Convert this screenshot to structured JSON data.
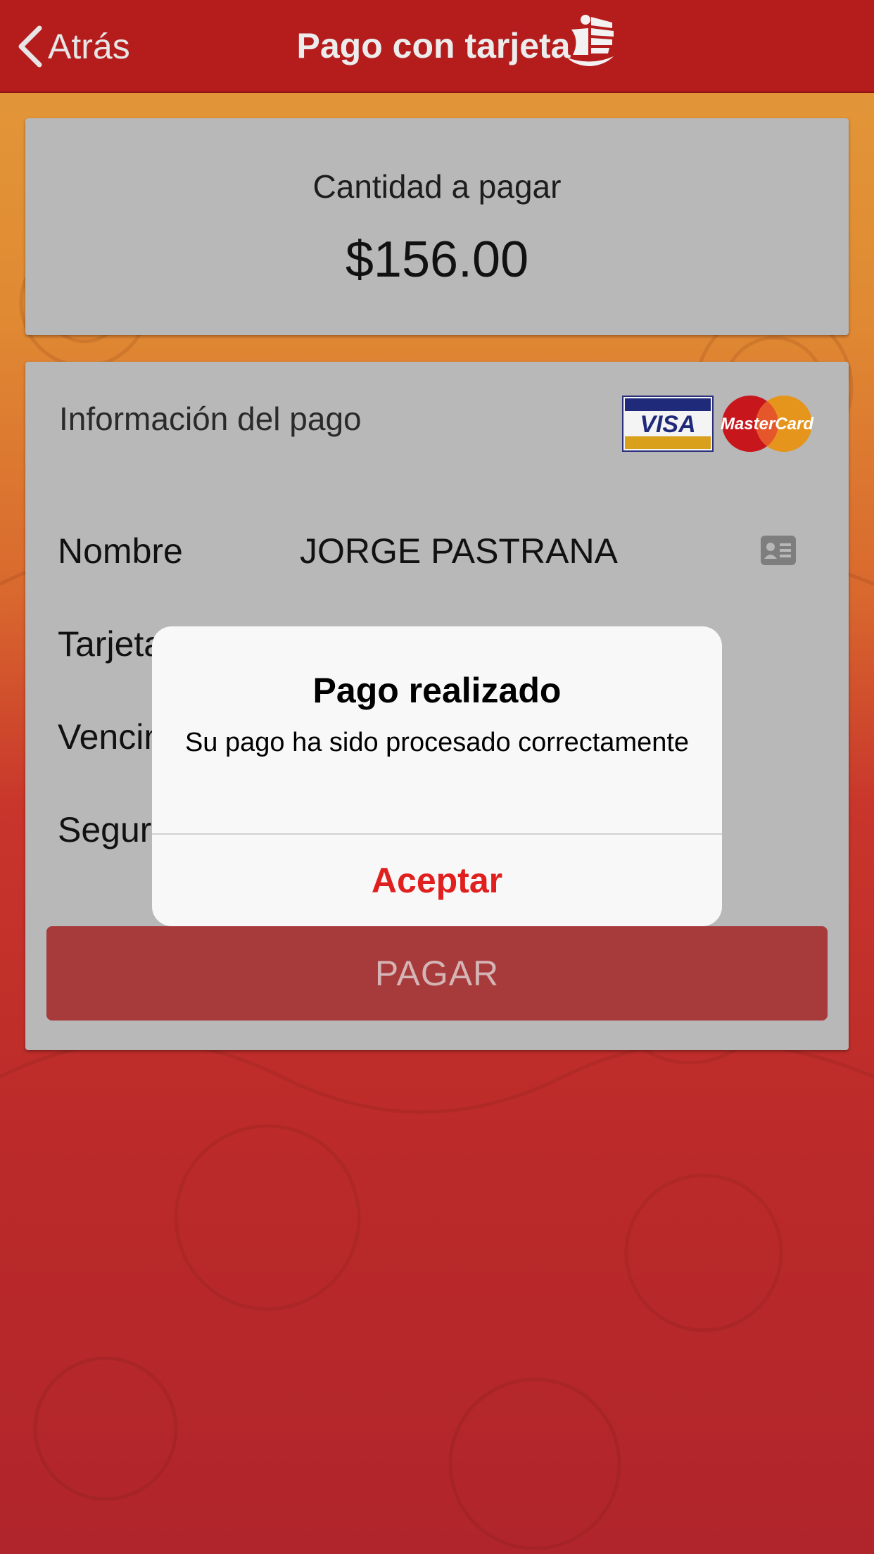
{
  "navbar": {
    "back_label": "Atrás",
    "title": "Pago con tarjeta"
  },
  "amount": {
    "label": "Cantidad a pagar",
    "value": "$156.00"
  },
  "payment_info": {
    "title": "Información del pago",
    "card_brands": [
      "VISA",
      "MasterCard"
    ],
    "rows": [
      {
        "label": "Nombre",
        "value": "JORGE PASTRANA"
      },
      {
        "label": "Tarjeta",
        "value": ""
      },
      {
        "label": "Vencimiento",
        "value": ""
      },
      {
        "label": "Seguridad",
        "value": ""
      }
    ],
    "pay_button": "PAGAR"
  },
  "alert": {
    "title": "Pago realizado",
    "message": "Su pago ha sido procesado correctamente",
    "button": "Aceptar"
  },
  "colors": {
    "navbar": "#b51c1c",
    "accent_red": "#e0201f",
    "card_gray": "#b8b8b8",
    "pay_button": "#a73b3b"
  },
  "icons": [
    "chevron-left-icon",
    "junk-boat-logo",
    "contact-card-icon",
    "visa-logo",
    "mastercard-logo"
  ]
}
